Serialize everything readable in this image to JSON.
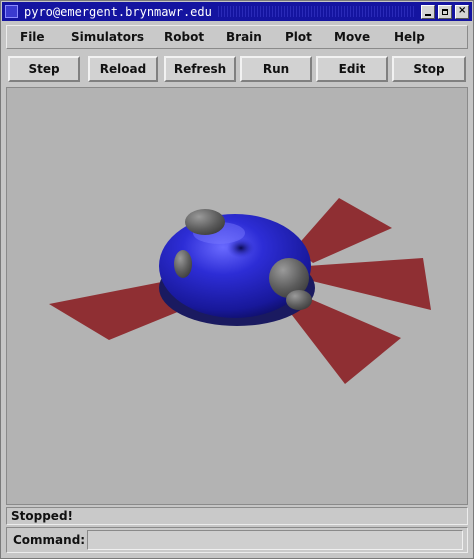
{
  "window": {
    "title": "pyro@emergent.brynmawr.edu"
  },
  "menubar": {
    "items": [
      {
        "label": "File"
      },
      {
        "label": "Simulators"
      },
      {
        "label": "Robot"
      },
      {
        "label": "Brain"
      },
      {
        "label": "Plot"
      },
      {
        "label": "Move"
      },
      {
        "label": "Help"
      }
    ]
  },
  "toolbar": {
    "buttons": [
      {
        "label": "Step"
      },
      {
        "label": "Reload"
      },
      {
        "label": "Refresh"
      },
      {
        "label": "Run"
      },
      {
        "label": "Edit"
      },
      {
        "label": "Stop"
      }
    ]
  },
  "viewport": {
    "background_color": "#b3b3b3",
    "robot_body_color": "#2a2ab4",
    "sensor_beam_color": "#8f2f33",
    "bumper_color": "#6b6b6b"
  },
  "status": {
    "text": "Stopped!"
  },
  "command": {
    "label": "Command:",
    "value": ""
  }
}
